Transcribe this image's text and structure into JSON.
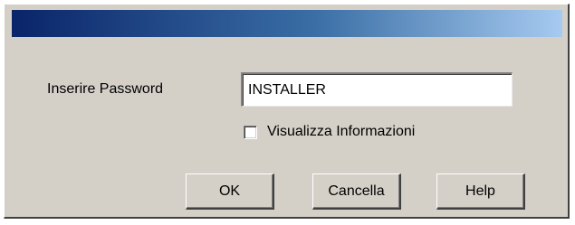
{
  "dialog": {
    "password_label": "Inserire Password",
    "password_value": "INSTALLER",
    "show_info_label": "Visualizza Informazioni",
    "show_info_checked": false,
    "buttons": {
      "ok": "OK",
      "cancel": "Cancella",
      "help": "Help"
    }
  },
  "colors": {
    "face": "#d4d0c8",
    "titlebar_start": "#0a246a",
    "titlebar_end": "#a6caf0"
  }
}
